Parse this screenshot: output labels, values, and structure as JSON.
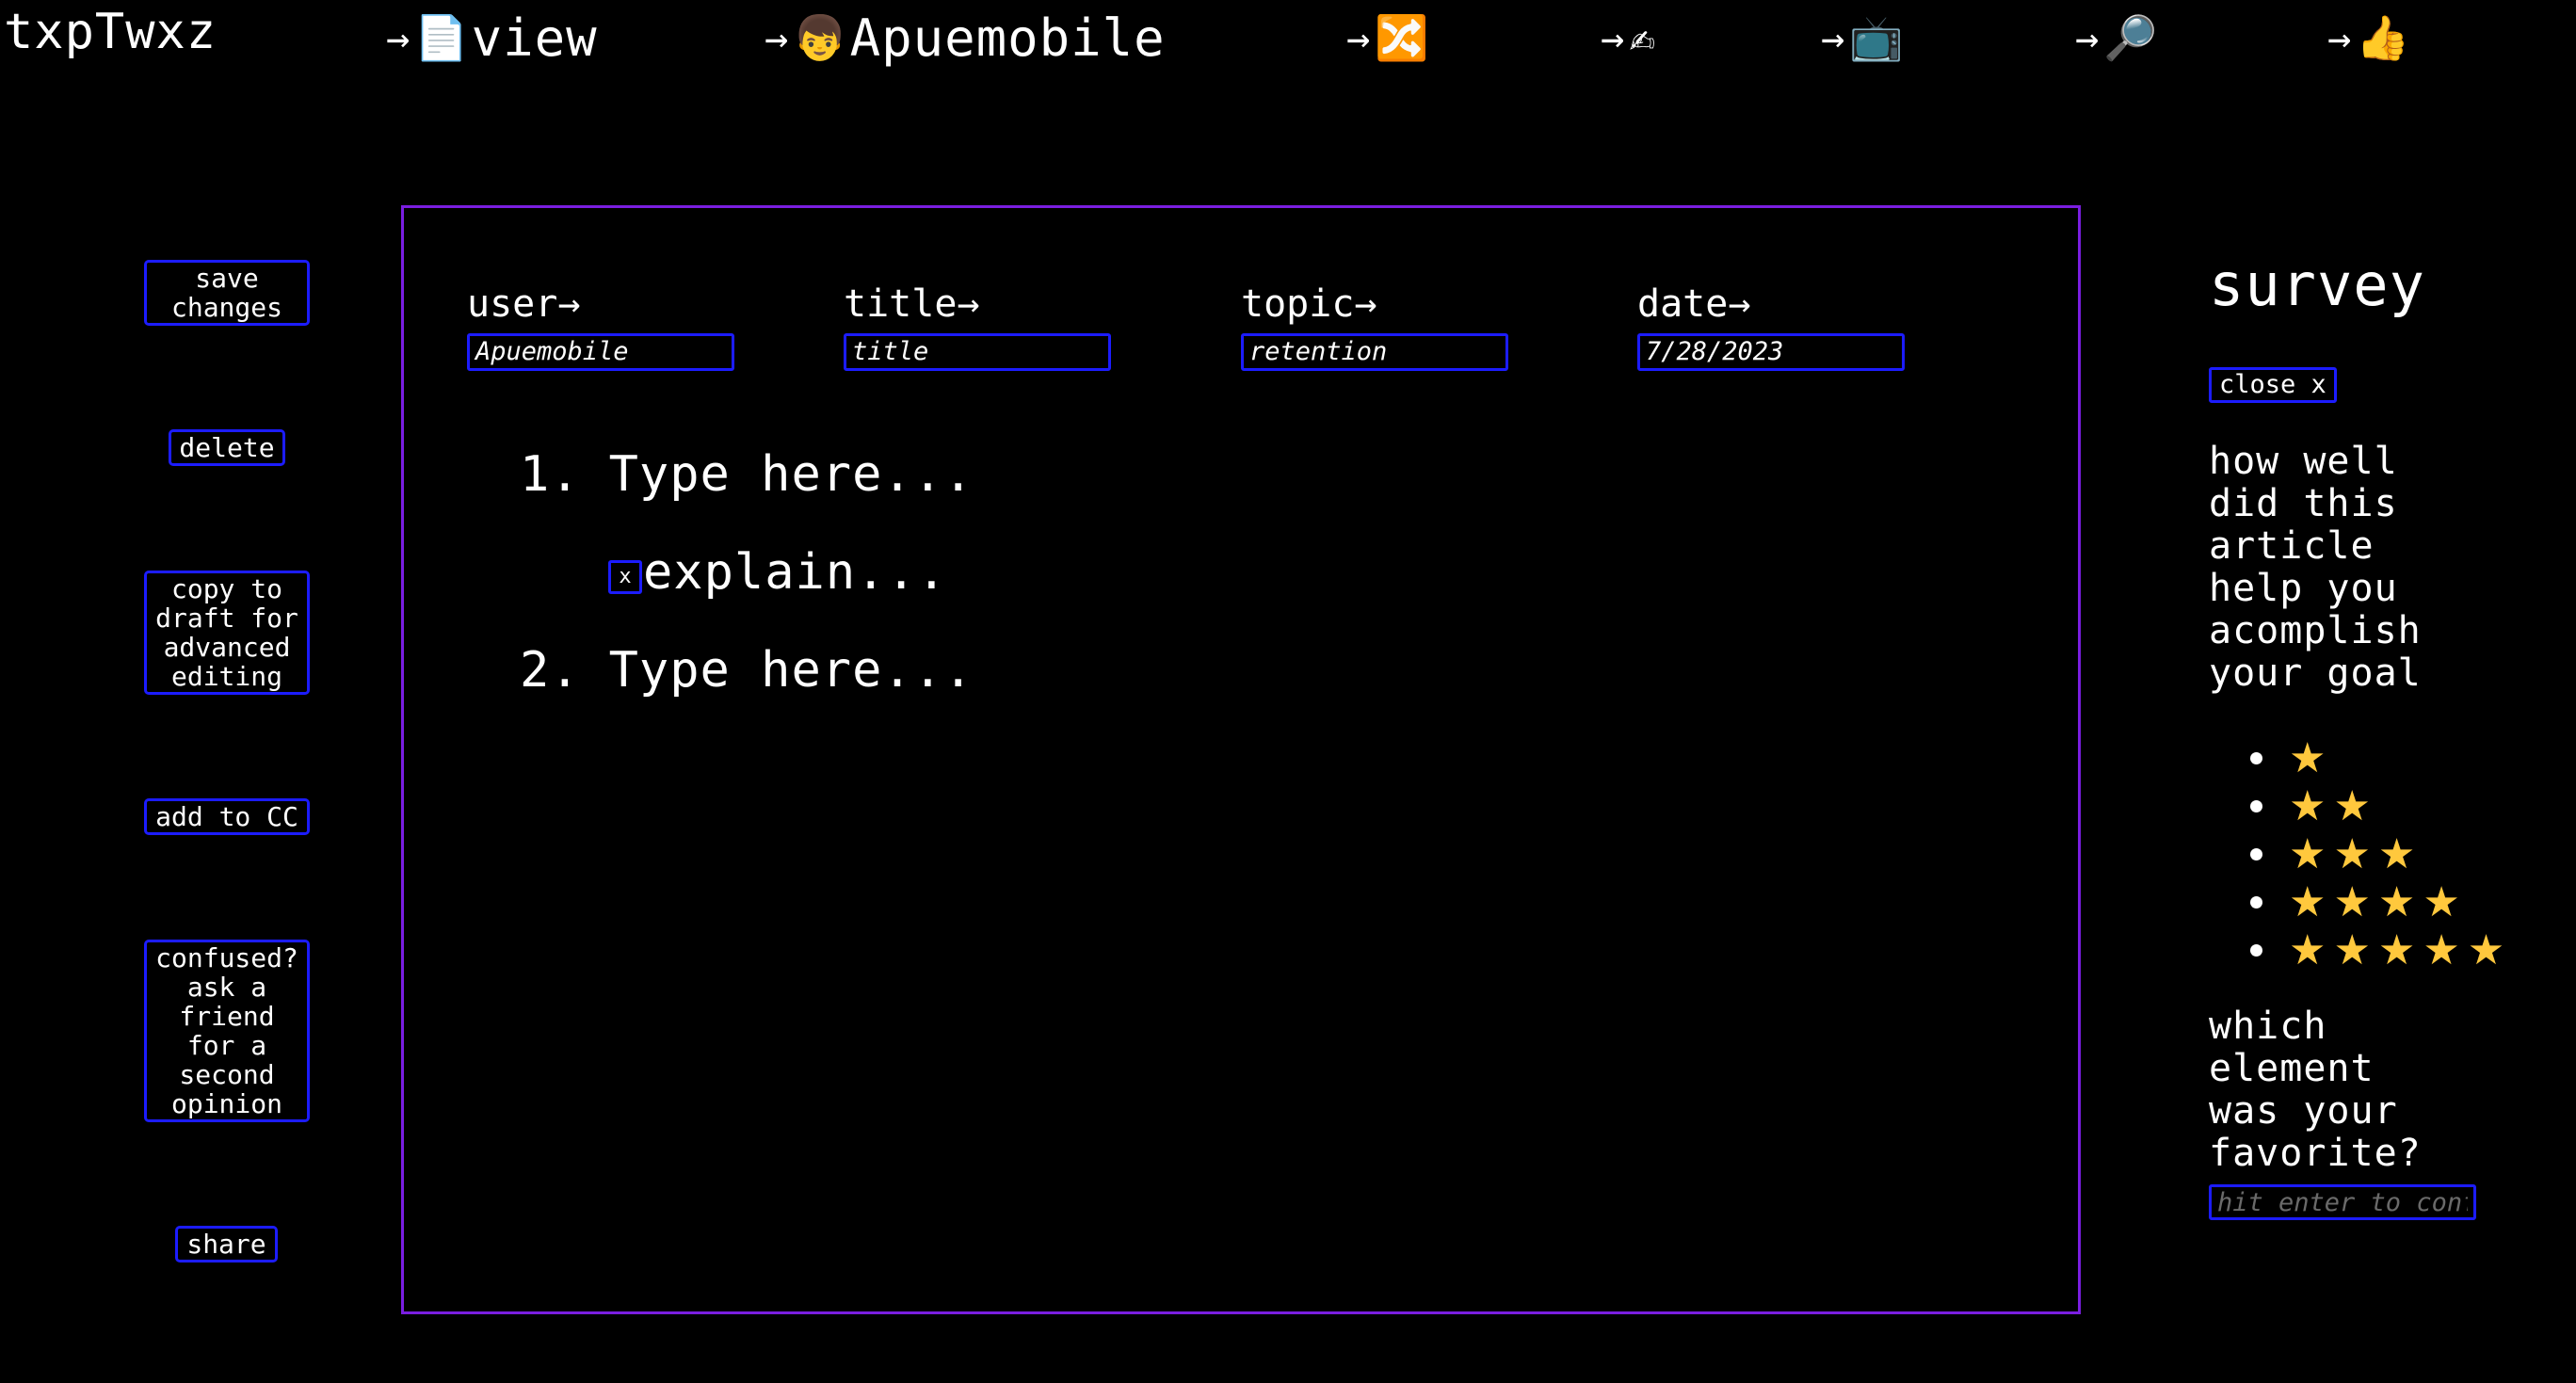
{
  "brand": "txpTwxz",
  "nav": [
    {
      "arrow": "→",
      "icon": "page-icon",
      "glyph": "📄",
      "label": "view"
    },
    {
      "arrow": "→",
      "icon": "boy-face-icon",
      "glyph": "👦",
      "label": "Apuemobile"
    },
    {
      "arrow": "→",
      "icon": "shuffle-icon",
      "glyph": "🔀",
      "label": ""
    },
    {
      "arrow": "→",
      "icon": "writing-hand-icon",
      "glyph": "✍",
      "label": ""
    },
    {
      "arrow": "→",
      "icon": "television-icon",
      "glyph": "📺",
      "label": ""
    },
    {
      "arrow": "→",
      "icon": "magnifier-icon",
      "glyph": "🔎",
      "label": ""
    },
    {
      "arrow": "→",
      "icon": "thumbs-up-icon",
      "glyph": "👍",
      "label": ""
    }
  ],
  "actions": {
    "save": "save\nchanges",
    "delete": "delete",
    "copy": "copy to\ndraft for\nadvanced\nediting",
    "add_cc": "add to CC",
    "confused": "confused?\nask a\nfriend\nfor a\nsecond\nopinion",
    "share": "share"
  },
  "fields": {
    "user": {
      "label": "user→",
      "value": "Apuemobile"
    },
    "title": {
      "label": "title→",
      "value": "title"
    },
    "topic": {
      "label": "topic→",
      "value": "retention"
    },
    "date": {
      "label": "date→",
      "value": "7/28/2023"
    }
  },
  "list": {
    "item1_number": "1.",
    "item1_text": "Type here...",
    "explain_remove": "x",
    "explain_text": "explain...",
    "item2_number": "2.",
    "item2_text": "Type here..."
  },
  "survey": {
    "title": "survey",
    "close_label": "close x",
    "question1": "how well\ndid this\narticle\nhelp you\nacomplish\nyour goal",
    "ratings": [
      "★",
      "★★",
      "★★★",
      "★★★★",
      "★★★★★"
    ],
    "star_color": "#ffc83d",
    "question2": "which\nelement\nwas your\nfavorite?",
    "favorite_placeholder": "hit enter to confirm"
  },
  "colors": {
    "background": "#000000",
    "panel_border": "#7a1ee0",
    "control_border": "#1c1cff"
  }
}
